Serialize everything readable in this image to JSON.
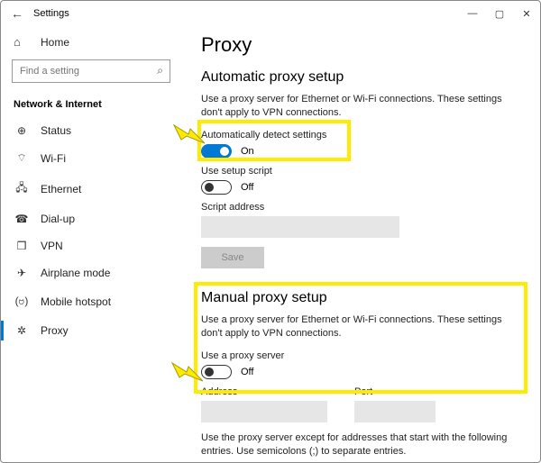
{
  "window": {
    "title": "Settings"
  },
  "sidebar": {
    "home": "Home",
    "search_placeholder": "Find a setting",
    "section": "Network & Internet",
    "items": [
      {
        "label": "Status",
        "icon": "⊕"
      },
      {
        "label": "Wi-Fi",
        "icon": "⌔"
      },
      {
        "label": "Ethernet",
        "icon": "🖧"
      },
      {
        "label": "Dial-up",
        "icon": "☎"
      },
      {
        "label": "VPN",
        "icon": "❒"
      },
      {
        "label": "Airplane mode",
        "icon": "✈"
      },
      {
        "label": "Mobile hotspot",
        "icon": "(ဗ)"
      },
      {
        "label": "Proxy",
        "icon": "✲",
        "active": true
      }
    ]
  },
  "page": {
    "title": "Proxy"
  },
  "auto": {
    "heading": "Automatic proxy setup",
    "desc": "Use a proxy server for Ethernet or Wi-Fi connections. These settings don't apply to VPN connections.",
    "detect_label": "Automatically detect settings",
    "detect_state": "On",
    "script_label": "Use setup script",
    "script_state": "Off",
    "address_label": "Script address",
    "save": "Save"
  },
  "manual": {
    "heading": "Manual proxy setup",
    "desc": "Use a proxy server for Ethernet or Wi-Fi connections. These settings don't apply to VPN connections.",
    "use_label": "Use a proxy server",
    "use_state": "Off",
    "address_label": "Address",
    "port_label": "Port",
    "except_desc": "Use the proxy server except for addresses that start with the following entries. Use semicolons (;) to separate entries."
  }
}
